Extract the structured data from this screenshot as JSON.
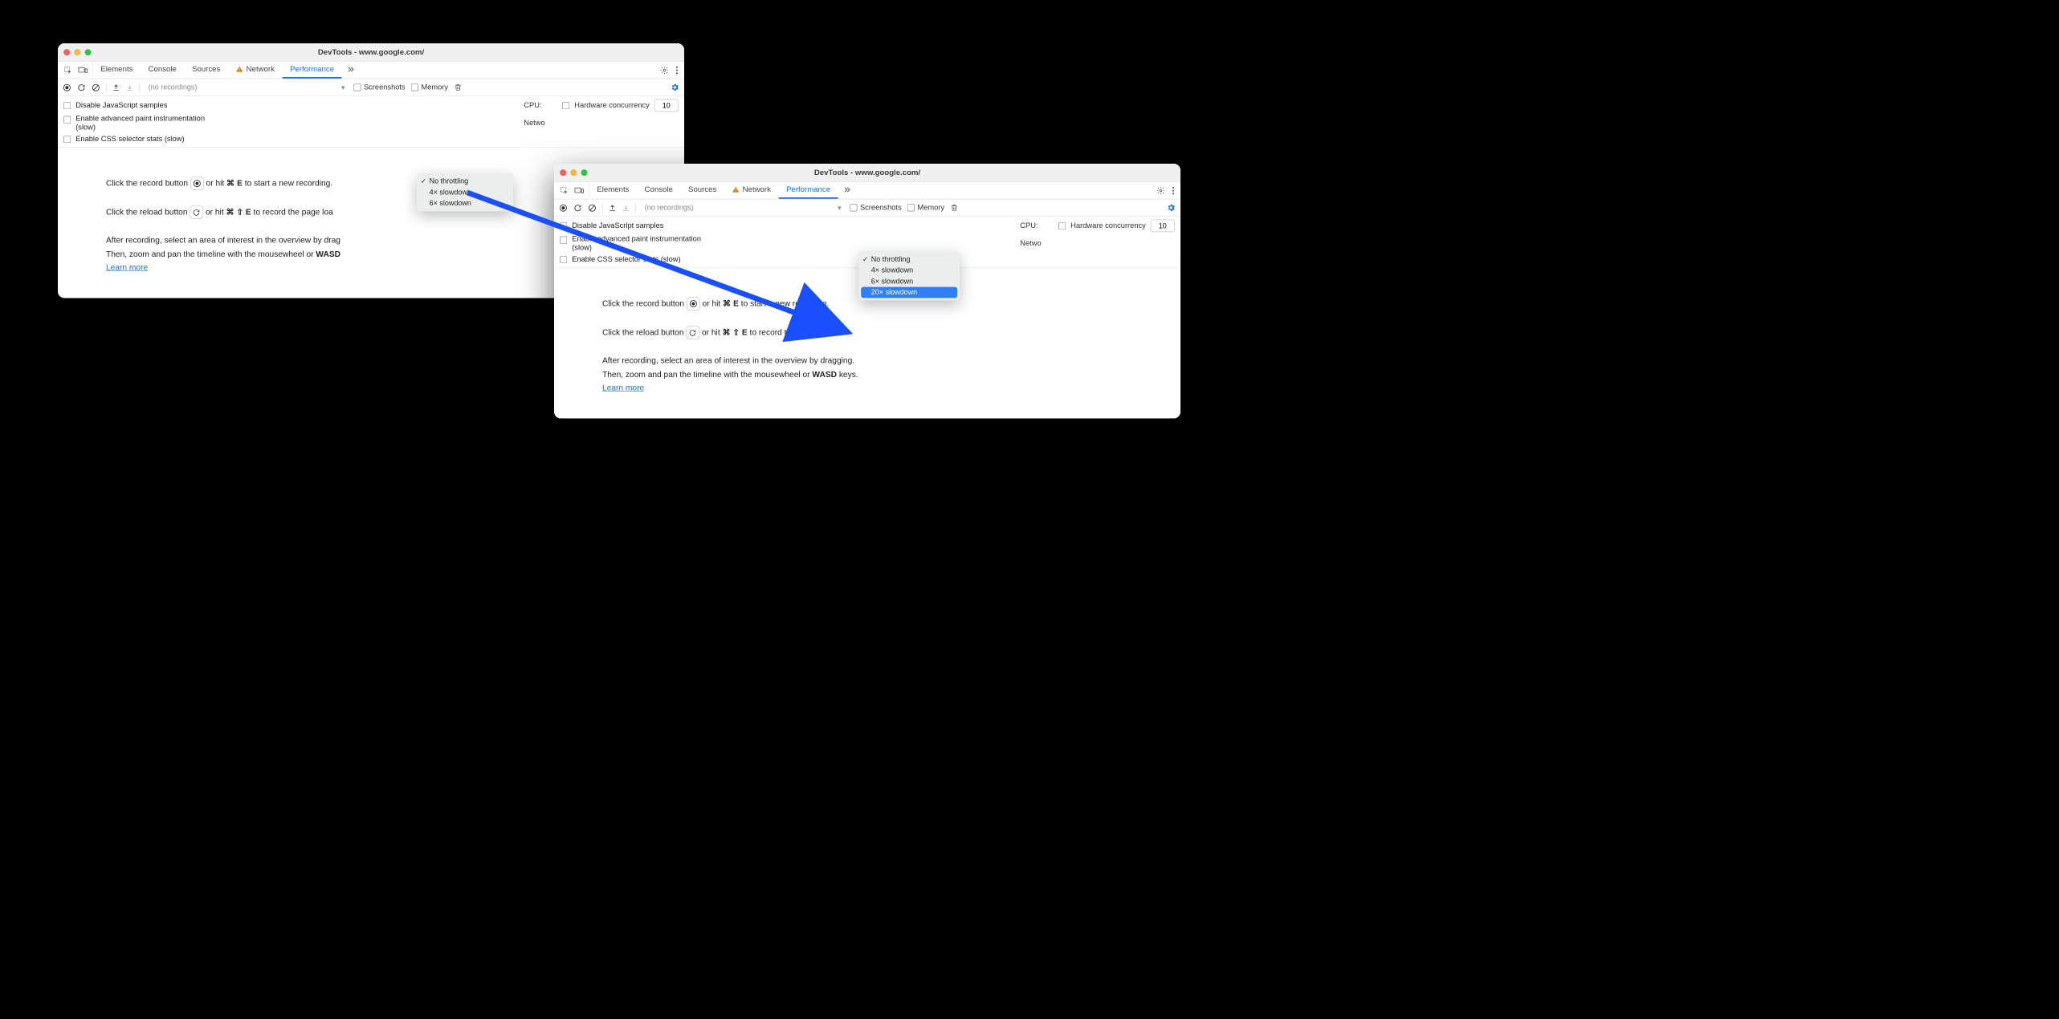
{
  "window_left": {
    "title": "DevTools - www.google.com/",
    "tabs": [
      "Elements",
      "Console",
      "Sources",
      "Network",
      "Performance"
    ],
    "active_tab": "Performance",
    "network_warning": true,
    "recordings_label": "(no recordings)",
    "chk_screenshots": "Screenshots",
    "chk_memory": "Memory",
    "settings": {
      "disable_js": "Disable JavaScript samples",
      "adv_paint": "Enable advanced paint instrumentation (slow)",
      "css_stats": "Enable CSS selector stats (slow)",
      "cpu_label": "CPU:",
      "network_label": "Netwo",
      "hw_label": "Hardware concurrency",
      "hw_value": "10"
    },
    "dropdown": {
      "items": [
        "No throttling",
        "4× slowdown",
        "6× slowdown"
      ],
      "checked": "No throttling"
    },
    "body": {
      "record_prefix": "Click the record button",
      "record_mid": "or hit",
      "record_kbd": "⌘ E",
      "record_suffix": "to start a new recording.",
      "reload_prefix": "Click the reload button",
      "reload_mid": "or hit",
      "reload_kbd": "⌘ ⇧ E",
      "reload_suffix": "to record the page loa",
      "after1": "After recording, select an area of interest in the overview by drag",
      "after2_a": "Then, zoom and pan the timeline with the mousewheel or ",
      "after2_b": "WASD",
      "learn": "Learn more"
    }
  },
  "window_right": {
    "title": "DevTools - www.google.com/",
    "tabs": [
      "Elements",
      "Console",
      "Sources",
      "Network",
      "Performance"
    ],
    "active_tab": "Performance",
    "network_warning": true,
    "recordings_label": "(no recordings)",
    "chk_screenshots": "Screenshots",
    "chk_memory": "Memory",
    "settings": {
      "disable_js": "Disable JavaScript samples",
      "adv_paint": "Enable advanced paint instrumentation (slow)",
      "css_stats": "Enable CSS selector stats (slow)",
      "cpu_label": "CPU:",
      "network_label": "Netwo",
      "hw_label": "Hardware concurrency",
      "hw_value": "10"
    },
    "dropdown": {
      "items": [
        "No throttling",
        "4× slowdown",
        "6× slowdown",
        "20× slowdown"
      ],
      "checked": "No throttling",
      "selected": "20× slowdown"
    },
    "body": {
      "record_prefix": "Click the record button",
      "record_mid": "or hit",
      "record_kbd": "⌘ E",
      "record_suffix": "to start a new recording.",
      "reload_prefix": "Click the reload button",
      "reload_mid": "or hit",
      "reload_kbd": "⌘ ⇧ E",
      "reload_suffix": "to record the page load.",
      "after1": "After recording, select an area of interest in the overview by dragging.",
      "after2_a": "Then, zoom and pan the timeline with the mousewheel or ",
      "after2_b": "WASD",
      "after2_c": " keys.",
      "learn": "Learn more"
    }
  }
}
